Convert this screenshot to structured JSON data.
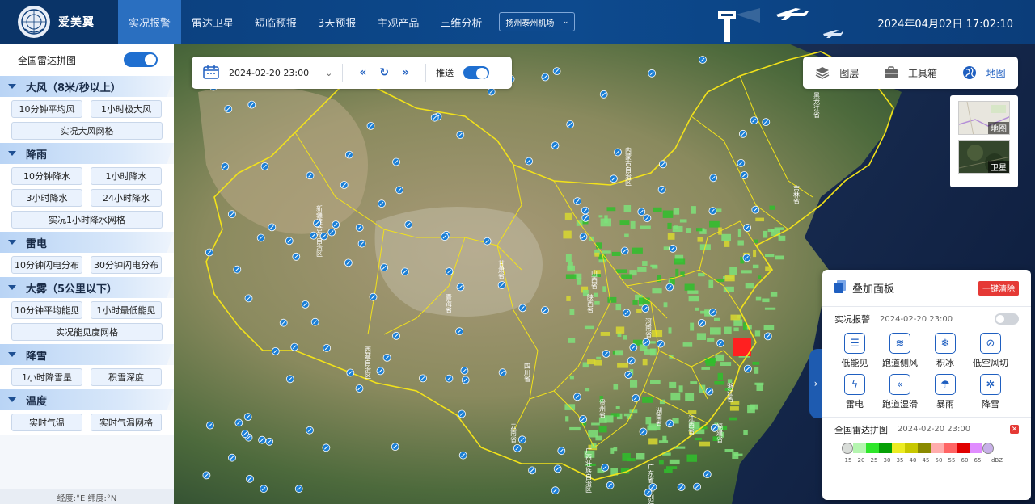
{
  "header": {
    "app_name": "爱美翼",
    "nav": [
      "实况报警",
      "雷达卫星",
      "短临预报",
      "3天预报",
      "主观产品",
      "三维分析"
    ],
    "active_nav": 0,
    "airport_select": "扬州泰州机场",
    "datetime": "2024年04月02日 17:02:10"
  },
  "sidebar": {
    "top_toggle_label": "全国雷达拼图",
    "top_toggle_on": true,
    "categories": [
      {
        "title": "大风（8米/秒以上）",
        "buttons": [
          {
            "label": "10分钟平均风",
            "wide": false
          },
          {
            "label": "1小时极大风",
            "wide": false
          },
          {
            "label": "实况大风网格",
            "wide": true
          }
        ]
      },
      {
        "title": "降雨",
        "buttons": [
          {
            "label": "10分钟降水",
            "wide": false
          },
          {
            "label": "1小时降水",
            "wide": false
          },
          {
            "label": "3小时降水",
            "wide": false
          },
          {
            "label": "24小时降水",
            "wide": false
          },
          {
            "label": "实况1小时降水网格",
            "wide": true
          }
        ]
      },
      {
        "title": "雷电",
        "buttons": [
          {
            "label": "10分钟闪电分布",
            "wide": false
          },
          {
            "label": "30分钟闪电分布",
            "wide": false
          }
        ]
      },
      {
        "title": "大雾（5公里以下）",
        "buttons": [
          {
            "label": "10分钟平均能见",
            "wide": false
          },
          {
            "label": "1小时最低能见",
            "wide": false
          },
          {
            "label": "实况能见度网格",
            "wide": true
          }
        ]
      },
      {
        "title": "降雪",
        "buttons": [
          {
            "label": "1小时降雪量",
            "wide": false
          },
          {
            "label": "积雪深度",
            "wide": false
          }
        ]
      },
      {
        "title": "温度",
        "buttons": [
          {
            "label": "实时气温",
            "wide": false
          },
          {
            "label": "实时气温网格",
            "wide": false
          }
        ]
      }
    ],
    "coord_text": "经度:°E  纬度:°N"
  },
  "timebar": {
    "time": "2024-02-20 23:00",
    "push_label": "推送",
    "push_on": true
  },
  "toolbar": {
    "items": [
      {
        "label": "图层",
        "icon": "layers-icon"
      },
      {
        "label": "工具箱",
        "icon": "toolbox-icon"
      },
      {
        "label": "地图",
        "icon": "globe-icon"
      }
    ],
    "active": 2
  },
  "basemap": {
    "options": [
      "地图",
      "卫星"
    ]
  },
  "map_labels": [
    "黑龙江省",
    "内蒙古自治区",
    "吉林省",
    "新疆维吾尔自治区",
    "甘肃省",
    "青海省",
    "西藏自治区",
    "四川省",
    "云南省",
    "陕西省",
    "河南省",
    "广西壮族自治区",
    "浙江省",
    "江西省",
    "福建省",
    "湖南省",
    "贵州省",
    "广东省",
    "山西省",
    "特别行政区"
  ],
  "overlay": {
    "title": "叠加面板",
    "clear_label": "一键清除",
    "alarm": {
      "label": "实况报警",
      "time": "2024-02-20 23:00",
      "on": false
    },
    "alarm_items": [
      {
        "label": "低能见",
        "icon": "list-icon",
        "glyph": "☰"
      },
      {
        "label": "跑道侧风",
        "icon": "wind-icon",
        "glyph": "≋"
      },
      {
        "label": "积冰",
        "icon": "ice-icon",
        "glyph": "❄"
      },
      {
        "label": "低空风切",
        "icon": "windshear-icon",
        "glyph": "⊘"
      },
      {
        "label": "雷电",
        "icon": "thunder-icon",
        "glyph": "ϟ"
      },
      {
        "label": "跑道湿滑",
        "icon": "slippery-icon",
        "glyph": "«"
      },
      {
        "label": "暴雨",
        "icon": "rain-icon",
        "glyph": "☂"
      },
      {
        "label": "降雪",
        "icon": "snow-icon",
        "glyph": "✲"
      }
    ],
    "radar": {
      "label": "全国雷达拼图",
      "time": "2024-02-20 23:00"
    },
    "legend": {
      "ticks": [
        "15",
        "20",
        "25",
        "30",
        "35",
        "40",
        "45",
        "50",
        "55",
        "60",
        "65"
      ],
      "colors": [
        "#b5f5b0",
        "#2ee62a",
        "#06a006",
        "#ecec22",
        "#c8c800",
        "#8a8a00",
        "#ffacac",
        "#ff6464",
        "#e00000",
        "#e08cff"
      ],
      "unit": "dBZ"
    }
  }
}
